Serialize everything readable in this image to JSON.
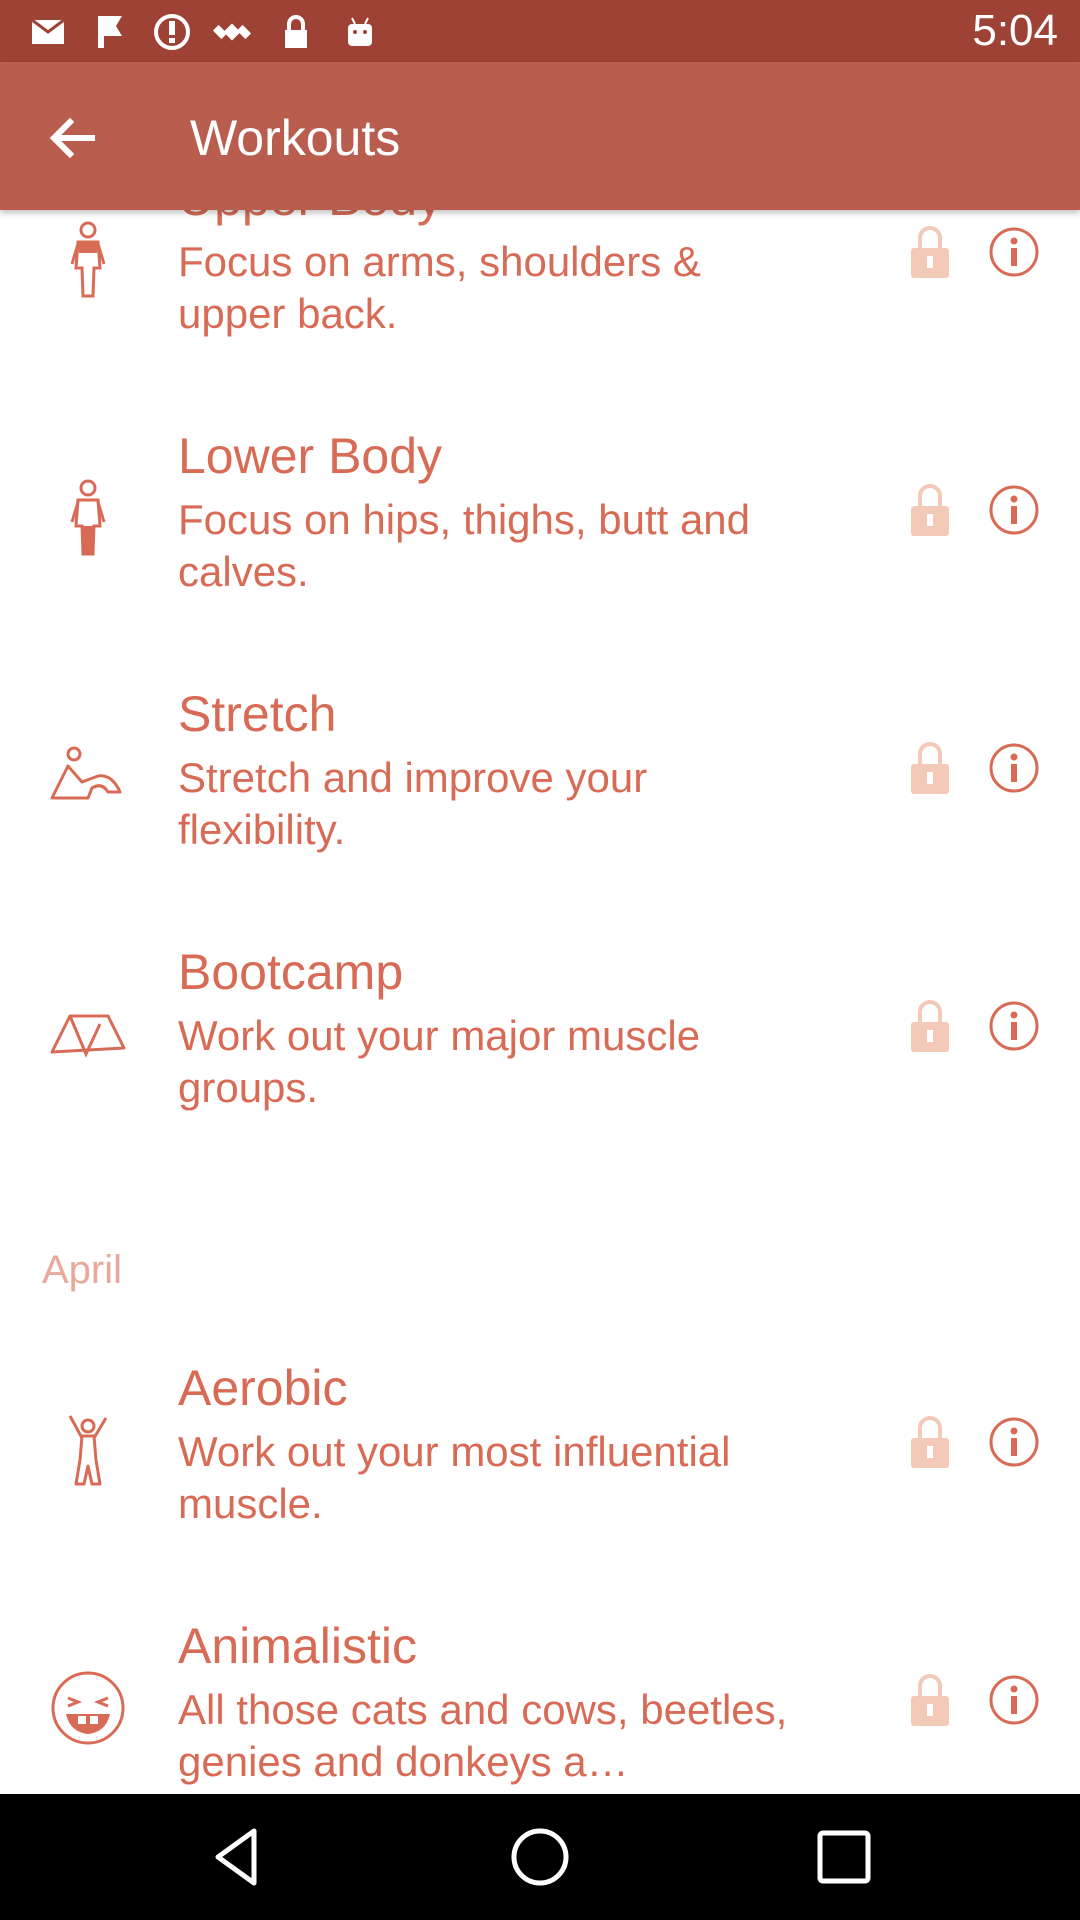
{
  "status_bar": {
    "time": "5:04",
    "notification_icons": [
      "mail-icon",
      "flag-icon",
      "alert-icon",
      "fake-gps-icon",
      "lock-icon",
      "android-icon"
    ]
  },
  "toolbar": {
    "title": "Workouts",
    "back_icon": "arrow-back-icon"
  },
  "workouts_top": [
    {
      "name": "Upper Body",
      "description": "Focus on arms, shoulders & upper back.",
      "icon": "upper-body-figure-icon"
    },
    {
      "name": "Lower Body",
      "description": "Focus on hips, thighs, butt and calves.",
      "icon": "lower-body-figure-icon"
    },
    {
      "name": "Stretch",
      "description": "Stretch and improve your flexibility.",
      "icon": "stretch-pose-icon"
    },
    {
      "name": "Bootcamp",
      "description": "Work out your major muscle groups.",
      "icon": "tent-icon"
    }
  ],
  "section": {
    "title": "April"
  },
  "workouts_april": [
    {
      "name": "Aerobic",
      "description": "Work out your most influential muscle.",
      "icon": "jumping-figure-icon"
    },
    {
      "name": "Animalistic",
      "description": "All those cats and cows, beetles, genies and donkeys a…",
      "icon": "laughing-face-icon"
    }
  ],
  "row_icons": {
    "lock": "lock-icon",
    "info": "info-icon"
  },
  "colors": {
    "status_bar": "#9e4236",
    "toolbar": "#b95e4f",
    "accent": "#d86b55",
    "section_header": "#e8a99a",
    "lock": "#f3c9b8"
  },
  "nav": [
    "back-triangle-icon",
    "home-circle-icon",
    "recents-square-icon"
  ]
}
